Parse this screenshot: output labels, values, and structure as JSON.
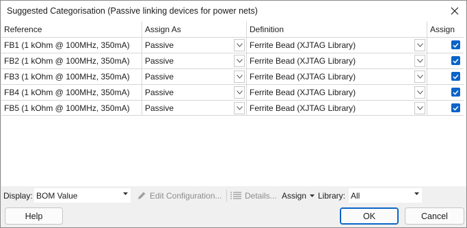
{
  "window": {
    "title": "Suggested Categorisation (Passive linking devices for power nets)"
  },
  "grid": {
    "columns": [
      "Reference",
      "Assign As",
      "Definition",
      "Assign"
    ],
    "rows": [
      {
        "reference": "FB1 (1 kOhm @ 100MHz, 350mA)",
        "assign_as": "Passive",
        "definition": "Ferrite Bead (XJTAG Library)",
        "assign": true
      },
      {
        "reference": "FB2 (1 kOhm @ 100MHz, 350mA)",
        "assign_as": "Passive",
        "definition": "Ferrite Bead (XJTAG Library)",
        "assign": true
      },
      {
        "reference": "FB3 (1 kOhm @ 100MHz, 350mA)",
        "assign_as": "Passive",
        "definition": "Ferrite Bead (XJTAG Library)",
        "assign": true
      },
      {
        "reference": "FB4 (1 kOhm @ 100MHz, 350mA)",
        "assign_as": "Passive",
        "definition": "Ferrite Bead (XJTAG Library)",
        "assign": true
      },
      {
        "reference": "FB5 (1 kOhm @ 100MHz, 350mA)",
        "assign_as": "Passive",
        "definition": "Ferrite Bead (XJTAG Library)",
        "assign": true
      }
    ]
  },
  "toolbar": {
    "display_label": "Display:",
    "display_value": "BOM Value",
    "edit_configuration_label": "Edit Configuration...",
    "details_label": "Details...",
    "assign_label": "Assign",
    "library_label": "Library:",
    "library_value": "All"
  },
  "buttons": {
    "help": "Help",
    "ok": "OK",
    "cancel": "Cancel"
  },
  "colors": {
    "accent": "#0a64c8",
    "window_bg": "#f0f0f0"
  }
}
